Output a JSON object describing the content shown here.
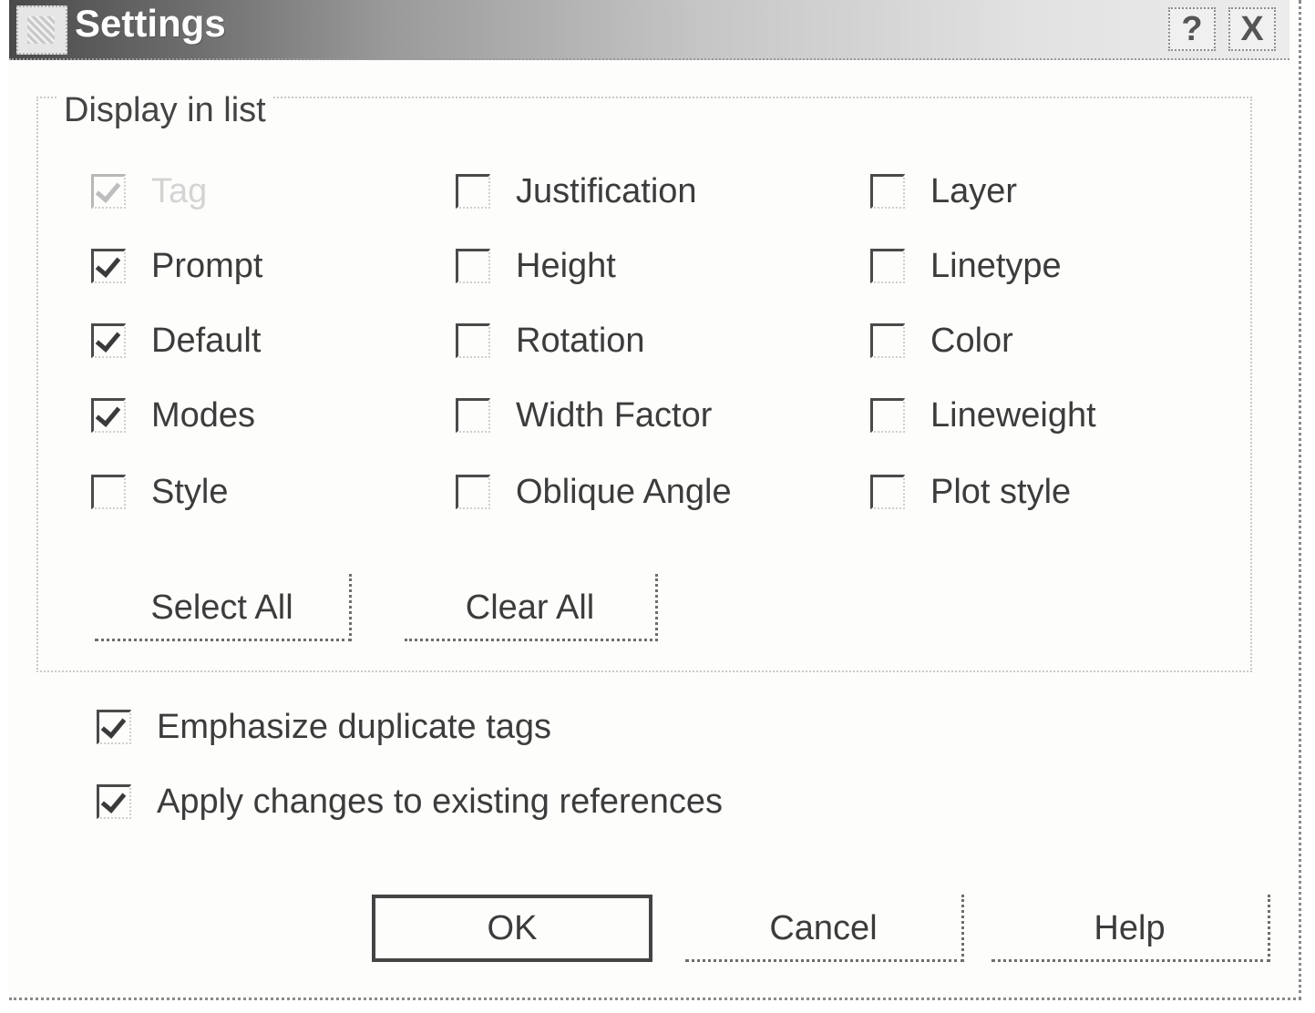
{
  "window": {
    "title": "Settings",
    "help_button": "?",
    "close_button": "X"
  },
  "group": {
    "label": "Display in list",
    "columns": [
      [
        {
          "label": "Tag",
          "checked": true,
          "disabled": true
        },
        {
          "label": "Prompt",
          "checked": true,
          "disabled": false
        },
        {
          "label": "Default",
          "checked": true,
          "disabled": false
        },
        {
          "label": "Modes",
          "checked": true,
          "disabled": false
        },
        {
          "label": "Style",
          "checked": false,
          "disabled": false
        }
      ],
      [
        {
          "label": "Justification",
          "checked": false,
          "disabled": false
        },
        {
          "label": "Height",
          "checked": false,
          "disabled": false
        },
        {
          "label": "Rotation",
          "checked": false,
          "disabled": false
        },
        {
          "label": "Width Factor",
          "checked": false,
          "disabled": false
        },
        {
          "label": "Oblique Angle",
          "checked": false,
          "disabled": false
        }
      ],
      [
        {
          "label": "Layer",
          "checked": false,
          "disabled": false
        },
        {
          "label": "Linetype",
          "checked": false,
          "disabled": false
        },
        {
          "label": "Color",
          "checked": false,
          "disabled": false
        },
        {
          "label": "Lineweight",
          "checked": false,
          "disabled": false
        },
        {
          "label": "Plot style",
          "checked": false,
          "disabled": false
        }
      ]
    ],
    "select_all_label": "Select All",
    "clear_all_label": "Clear All"
  },
  "options": [
    {
      "label": "Emphasize duplicate tags",
      "checked": true
    },
    {
      "label": "Apply changes to existing references",
      "checked": true
    }
  ],
  "footer": {
    "ok_label": "OK",
    "cancel_label": "Cancel",
    "help_label": "Help"
  }
}
